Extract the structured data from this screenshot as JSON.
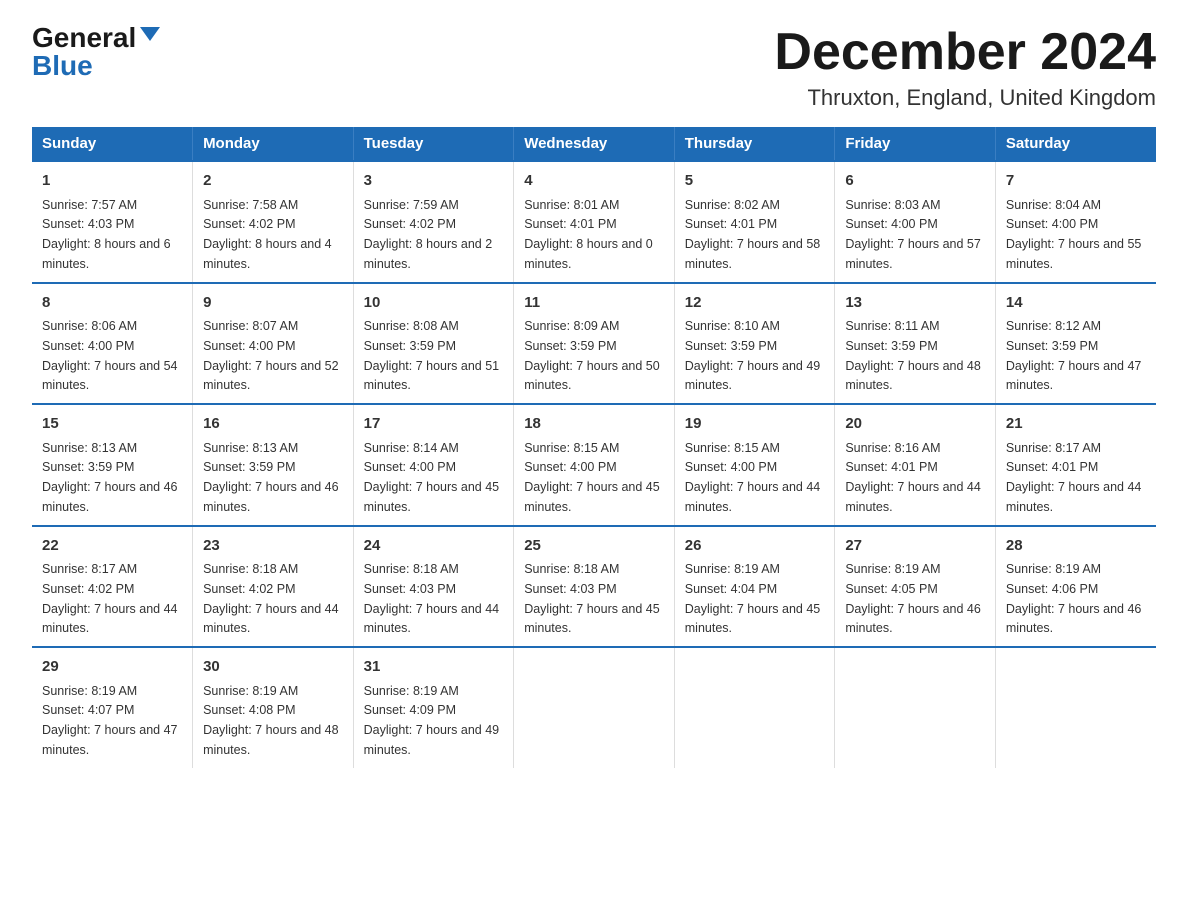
{
  "header": {
    "logo_general": "General",
    "logo_blue": "Blue",
    "title": "December 2024",
    "subtitle": "Thruxton, England, United Kingdom"
  },
  "days_of_week": [
    "Sunday",
    "Monday",
    "Tuesday",
    "Wednesday",
    "Thursday",
    "Friday",
    "Saturday"
  ],
  "weeks": [
    [
      {
        "day": "1",
        "sunrise": "Sunrise: 7:57 AM",
        "sunset": "Sunset: 4:03 PM",
        "daylight": "Daylight: 8 hours and 6 minutes."
      },
      {
        "day": "2",
        "sunrise": "Sunrise: 7:58 AM",
        "sunset": "Sunset: 4:02 PM",
        "daylight": "Daylight: 8 hours and 4 minutes."
      },
      {
        "day": "3",
        "sunrise": "Sunrise: 7:59 AM",
        "sunset": "Sunset: 4:02 PM",
        "daylight": "Daylight: 8 hours and 2 minutes."
      },
      {
        "day": "4",
        "sunrise": "Sunrise: 8:01 AM",
        "sunset": "Sunset: 4:01 PM",
        "daylight": "Daylight: 8 hours and 0 minutes."
      },
      {
        "day": "5",
        "sunrise": "Sunrise: 8:02 AM",
        "sunset": "Sunset: 4:01 PM",
        "daylight": "Daylight: 7 hours and 58 minutes."
      },
      {
        "day": "6",
        "sunrise": "Sunrise: 8:03 AM",
        "sunset": "Sunset: 4:00 PM",
        "daylight": "Daylight: 7 hours and 57 minutes."
      },
      {
        "day": "7",
        "sunrise": "Sunrise: 8:04 AM",
        "sunset": "Sunset: 4:00 PM",
        "daylight": "Daylight: 7 hours and 55 minutes."
      }
    ],
    [
      {
        "day": "8",
        "sunrise": "Sunrise: 8:06 AM",
        "sunset": "Sunset: 4:00 PM",
        "daylight": "Daylight: 7 hours and 54 minutes."
      },
      {
        "day": "9",
        "sunrise": "Sunrise: 8:07 AM",
        "sunset": "Sunset: 4:00 PM",
        "daylight": "Daylight: 7 hours and 52 minutes."
      },
      {
        "day": "10",
        "sunrise": "Sunrise: 8:08 AM",
        "sunset": "Sunset: 3:59 PM",
        "daylight": "Daylight: 7 hours and 51 minutes."
      },
      {
        "day": "11",
        "sunrise": "Sunrise: 8:09 AM",
        "sunset": "Sunset: 3:59 PM",
        "daylight": "Daylight: 7 hours and 50 minutes."
      },
      {
        "day": "12",
        "sunrise": "Sunrise: 8:10 AM",
        "sunset": "Sunset: 3:59 PM",
        "daylight": "Daylight: 7 hours and 49 minutes."
      },
      {
        "day": "13",
        "sunrise": "Sunrise: 8:11 AM",
        "sunset": "Sunset: 3:59 PM",
        "daylight": "Daylight: 7 hours and 48 minutes."
      },
      {
        "day": "14",
        "sunrise": "Sunrise: 8:12 AM",
        "sunset": "Sunset: 3:59 PM",
        "daylight": "Daylight: 7 hours and 47 minutes."
      }
    ],
    [
      {
        "day": "15",
        "sunrise": "Sunrise: 8:13 AM",
        "sunset": "Sunset: 3:59 PM",
        "daylight": "Daylight: 7 hours and 46 minutes."
      },
      {
        "day": "16",
        "sunrise": "Sunrise: 8:13 AM",
        "sunset": "Sunset: 3:59 PM",
        "daylight": "Daylight: 7 hours and 46 minutes."
      },
      {
        "day": "17",
        "sunrise": "Sunrise: 8:14 AM",
        "sunset": "Sunset: 4:00 PM",
        "daylight": "Daylight: 7 hours and 45 minutes."
      },
      {
        "day": "18",
        "sunrise": "Sunrise: 8:15 AM",
        "sunset": "Sunset: 4:00 PM",
        "daylight": "Daylight: 7 hours and 45 minutes."
      },
      {
        "day": "19",
        "sunrise": "Sunrise: 8:15 AM",
        "sunset": "Sunset: 4:00 PM",
        "daylight": "Daylight: 7 hours and 44 minutes."
      },
      {
        "day": "20",
        "sunrise": "Sunrise: 8:16 AM",
        "sunset": "Sunset: 4:01 PM",
        "daylight": "Daylight: 7 hours and 44 minutes."
      },
      {
        "day": "21",
        "sunrise": "Sunrise: 8:17 AM",
        "sunset": "Sunset: 4:01 PM",
        "daylight": "Daylight: 7 hours and 44 minutes."
      }
    ],
    [
      {
        "day": "22",
        "sunrise": "Sunrise: 8:17 AM",
        "sunset": "Sunset: 4:02 PM",
        "daylight": "Daylight: 7 hours and 44 minutes."
      },
      {
        "day": "23",
        "sunrise": "Sunrise: 8:18 AM",
        "sunset": "Sunset: 4:02 PM",
        "daylight": "Daylight: 7 hours and 44 minutes."
      },
      {
        "day": "24",
        "sunrise": "Sunrise: 8:18 AM",
        "sunset": "Sunset: 4:03 PM",
        "daylight": "Daylight: 7 hours and 44 minutes."
      },
      {
        "day": "25",
        "sunrise": "Sunrise: 8:18 AM",
        "sunset": "Sunset: 4:03 PM",
        "daylight": "Daylight: 7 hours and 45 minutes."
      },
      {
        "day": "26",
        "sunrise": "Sunrise: 8:19 AM",
        "sunset": "Sunset: 4:04 PM",
        "daylight": "Daylight: 7 hours and 45 minutes."
      },
      {
        "day": "27",
        "sunrise": "Sunrise: 8:19 AM",
        "sunset": "Sunset: 4:05 PM",
        "daylight": "Daylight: 7 hours and 46 minutes."
      },
      {
        "day": "28",
        "sunrise": "Sunrise: 8:19 AM",
        "sunset": "Sunset: 4:06 PM",
        "daylight": "Daylight: 7 hours and 46 minutes."
      }
    ],
    [
      {
        "day": "29",
        "sunrise": "Sunrise: 8:19 AM",
        "sunset": "Sunset: 4:07 PM",
        "daylight": "Daylight: 7 hours and 47 minutes."
      },
      {
        "day": "30",
        "sunrise": "Sunrise: 8:19 AM",
        "sunset": "Sunset: 4:08 PM",
        "daylight": "Daylight: 7 hours and 48 minutes."
      },
      {
        "day": "31",
        "sunrise": "Sunrise: 8:19 AM",
        "sunset": "Sunset: 4:09 PM",
        "daylight": "Daylight: 7 hours and 49 minutes."
      },
      null,
      null,
      null,
      null
    ]
  ]
}
